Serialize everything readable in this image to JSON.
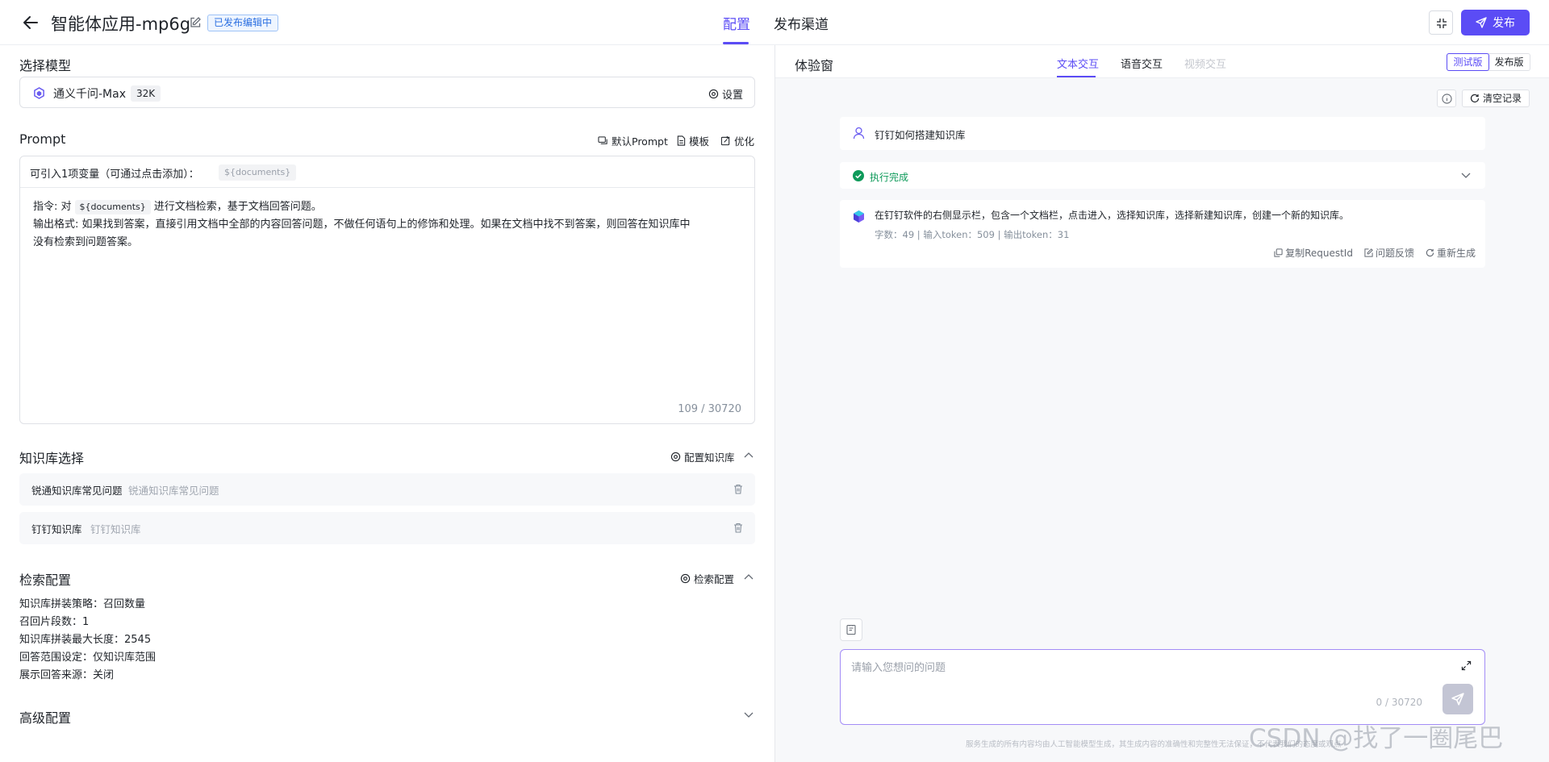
{
  "header": {
    "title": "智能体应用-mp6g",
    "status_badge": "已发布编辑中",
    "tabs": [
      "配置",
      "发布渠道"
    ],
    "publish_label": "发布"
  },
  "model": {
    "section_label": "选择模型",
    "name": "通义千问-Max",
    "context": "32K",
    "settings_label": "设置"
  },
  "prompt": {
    "section_label": "Prompt",
    "default_label": "默认Prompt",
    "template_label": "模板",
    "optimize_label": "优化",
    "var_label": "可引入1项变量（可通过点击添加）：",
    "var_chip": "${documents}",
    "line1_prefix": "指令: 对",
    "line1_var": "${documents}",
    "line1_suffix": "进行文档检索，基于文档回答问题。",
    "line2": "输出格式: 如果找到答案，直接引用文档中全部的内容回答问题，不做任何语句上的修饰和处理。如果在文档中找不到答案，则回答在知识库中",
    "line3": "没有检索到问题答案。",
    "char_count": "109 / 30720"
  },
  "knowledge": {
    "section_label": "知识库选择",
    "config_label": "配置知识库",
    "items": [
      {
        "name": "锐通知识库常见问题",
        "desc": "锐通知识库常见问题"
      },
      {
        "name": "钉钉知识库",
        "desc": "钉钉知识库"
      }
    ]
  },
  "retrieval": {
    "section_label": "检索配置",
    "config_label": "检索配置",
    "lines": [
      {
        "label": "知识库拼装策略：",
        "value": "召回数量"
      },
      {
        "label": "召回片段数：",
        "value": "1"
      },
      {
        "label": "知识库拼装最大长度：",
        "value": "2545"
      },
      {
        "label": "回答范围设定：",
        "value": "仅知识库范围"
      },
      {
        "label": "展示回答来源：",
        "value": "关闭"
      }
    ]
  },
  "advanced": {
    "section_label": "高级配置"
  },
  "experience": {
    "title": "体验窗",
    "modes": [
      "文本交互",
      "语音交互",
      "视频交互"
    ],
    "versions": [
      "测试版",
      "发布版"
    ],
    "clear_label": "清空记录",
    "question": "钉钉如何搭建知识库",
    "status": "执行完成",
    "answer": "在钉钉软件的右侧显示栏，包含一个文档栏，点击进入，选择知识库，选择新建知识库，创建一个新的知识库。",
    "meta": "字数：49  | 输入token：509 | 输出token：31",
    "actions": [
      "复制RequestId",
      "问题反馈",
      "重新生成"
    ],
    "input_placeholder": "请输入您想问的问题",
    "input_count": "0 / 30720",
    "disclaimer": "服务生成的所有内容均由人工智能模型生成，其生成内容的准确性和完整性无法保证，不代表我们的态度或观点"
  },
  "watermark": "CSDN @找了一圈尾巴",
  "colors": {
    "accent": "#5b4cf5",
    "success": "#0e9a5a",
    "badge_text": "#2b6fe0"
  }
}
